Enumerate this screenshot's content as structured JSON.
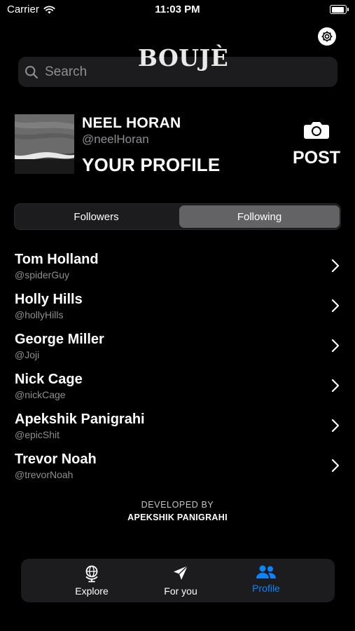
{
  "status_bar": {
    "carrier": "Carrier",
    "time": "11:03 PM"
  },
  "header": {
    "logo": "BOUJÈ"
  },
  "search": {
    "placeholder": "Search"
  },
  "profile": {
    "name": "NEEL HORAN",
    "handle": "@neelHoran",
    "title": "YOUR PROFILE",
    "post_label": "POST"
  },
  "segments": {
    "followers": "Followers",
    "following": "Following",
    "selected": "Following"
  },
  "following": [
    {
      "name": "Tom Holland",
      "handle": "@spiderGuy"
    },
    {
      "name": "Holly Hills",
      "handle": "@hollyHills"
    },
    {
      "name": "George Miller",
      "handle": "@Joji"
    },
    {
      "name": "Nick Cage",
      "handle": "@nickCage"
    },
    {
      "name": "Apekshik Panigrahi",
      "handle": "@epicShit"
    },
    {
      "name": "Trevor Noah",
      "handle": "@trevorNoah"
    }
  ],
  "footer": {
    "developed_by": "DEVELOPED BY",
    "developer": "APEKSHIK PANIGRAHI"
  },
  "tabbar": {
    "tabs": [
      {
        "label": "Explore",
        "icon": "globe-icon"
      },
      {
        "label": "For you",
        "icon": "paperplane-icon"
      },
      {
        "label": "Profile",
        "icon": "people-icon"
      }
    ],
    "active": "Profile"
  },
  "colors": {
    "accent": "#0a84ff",
    "background": "#000000",
    "card": "#1c1c1e",
    "secondary_text": "#8e8e93"
  },
  "icons": {
    "wifi": "wifi-icon",
    "battery": "battery-icon",
    "settings": "gear-icon",
    "search": "search-icon",
    "camera": "camera-icon",
    "chevron": "chevron-right-icon"
  }
}
